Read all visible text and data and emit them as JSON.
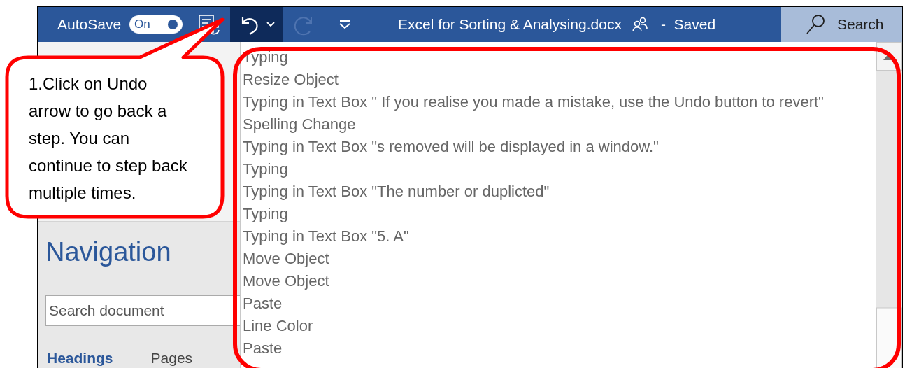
{
  "title_bar": {
    "autosave_label": "AutoSave",
    "autosave_toggle": {
      "label": "On",
      "on": true
    },
    "document_title": "Excel for Sorting & Analysing.docx",
    "save_status": "-  Saved",
    "search_label": "Search"
  },
  "undo_list": {
    "items": [
      {
        "label": "Typing"
      },
      {
        "label": "Resize Object"
      },
      {
        "label": "Typing in Text Box \" If you realise you made a mistake, use the Undo button to revert\""
      },
      {
        "label": "Spelling Change"
      },
      {
        "label": "Typing in Text Box \"s removed will be displayed in a window.\""
      },
      {
        "label": "Typing"
      },
      {
        "label": "Typing in Text Box \"The number or duplicted\""
      },
      {
        "label": "Typing"
      },
      {
        "label": "Typing in Text Box \"5. A\""
      },
      {
        "label": "Move Object"
      },
      {
        "label": "Move Object"
      },
      {
        "label": "Paste"
      },
      {
        "label": "Line Color"
      },
      {
        "label": "Paste"
      }
    ]
  },
  "navigation": {
    "title": "Navigation",
    "search": {
      "placeholder": "Search document"
    },
    "tabs": [
      {
        "label": "Headings",
        "selected": true
      },
      {
        "label": "Pages",
        "selected": false
      }
    ]
  },
  "callout": {
    "text": "1.Click on Undo arrow to go back a step. You can continue to step back multiple times."
  }
}
